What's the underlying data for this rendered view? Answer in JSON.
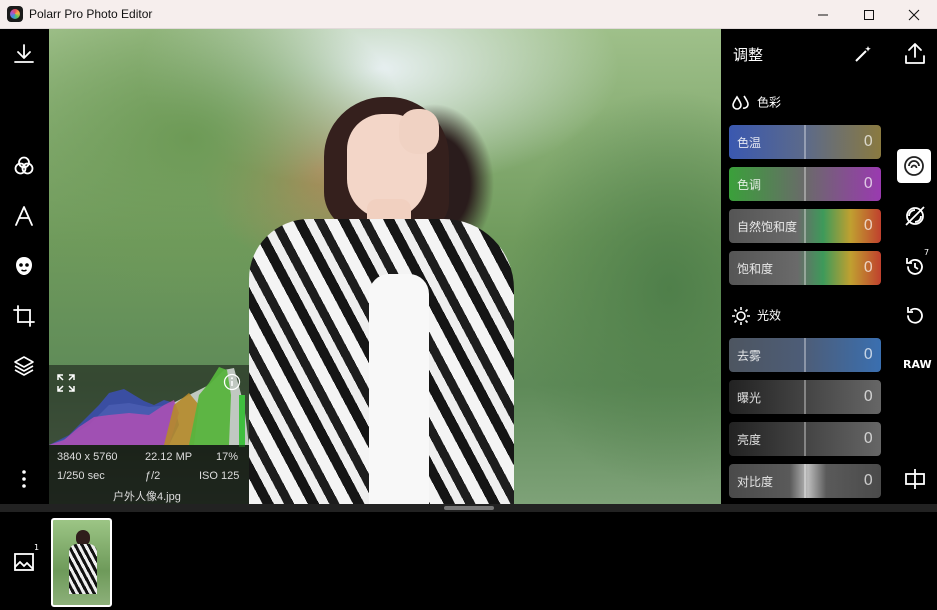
{
  "window": {
    "title": "Polarr Pro Photo Editor",
    "min_icon": "minimize-icon",
    "max_icon": "maximize-icon",
    "close_icon": "close-icon"
  },
  "left_toolbar": {
    "icons": [
      "download-icon",
      "filters-icon",
      "text-icon",
      "face-icon",
      "crop-icon",
      "layers-icon",
      "more-icon"
    ]
  },
  "histogram": {
    "resolution": "3840 x 5760",
    "megapixels": "22.12 MP",
    "zoom": "17%",
    "shutter": "1/250 sec",
    "aperture": "ƒ/2",
    "iso": "ISO 125",
    "filename": "户外人像4.jpg",
    "info_icon": "info-icon",
    "expand_icon": "expand-icon"
  },
  "panel": {
    "title": "调整",
    "wand_icon": "magic-wand-icon",
    "color_section": {
      "label": "色彩",
      "icon": "droplets-icon"
    },
    "color_sliders": [
      {
        "label": "色温",
        "value": "0"
      },
      {
        "label": "色调",
        "value": "0"
      },
      {
        "label": "自然饱和度",
        "value": "0"
      },
      {
        "label": "饱和度",
        "value": "0"
      }
    ],
    "light_section": {
      "label": "光效",
      "icon": "sun-icon"
    },
    "light_sliders": [
      {
        "label": "去雾",
        "value": "0"
      },
      {
        "label": "曝光",
        "value": "0"
      },
      {
        "label": "亮度",
        "value": "0"
      },
      {
        "label": "对比度",
        "value": "0"
      }
    ]
  },
  "right_toolbar": {
    "icons": [
      "share-icon",
      "adjust-icon",
      "mask-icon",
      "history-icon",
      "reset-icon",
      "raw-label",
      "compare-icon"
    ],
    "history_count": "7",
    "raw_label": "RAW"
  },
  "filmstrip": {
    "count": "1",
    "gallery_icon": "gallery-icon"
  },
  "colors": {
    "accent_blue": "#3a6fb0",
    "panel_bg": "#000000",
    "titlebar_bg": "#f6eeed"
  }
}
